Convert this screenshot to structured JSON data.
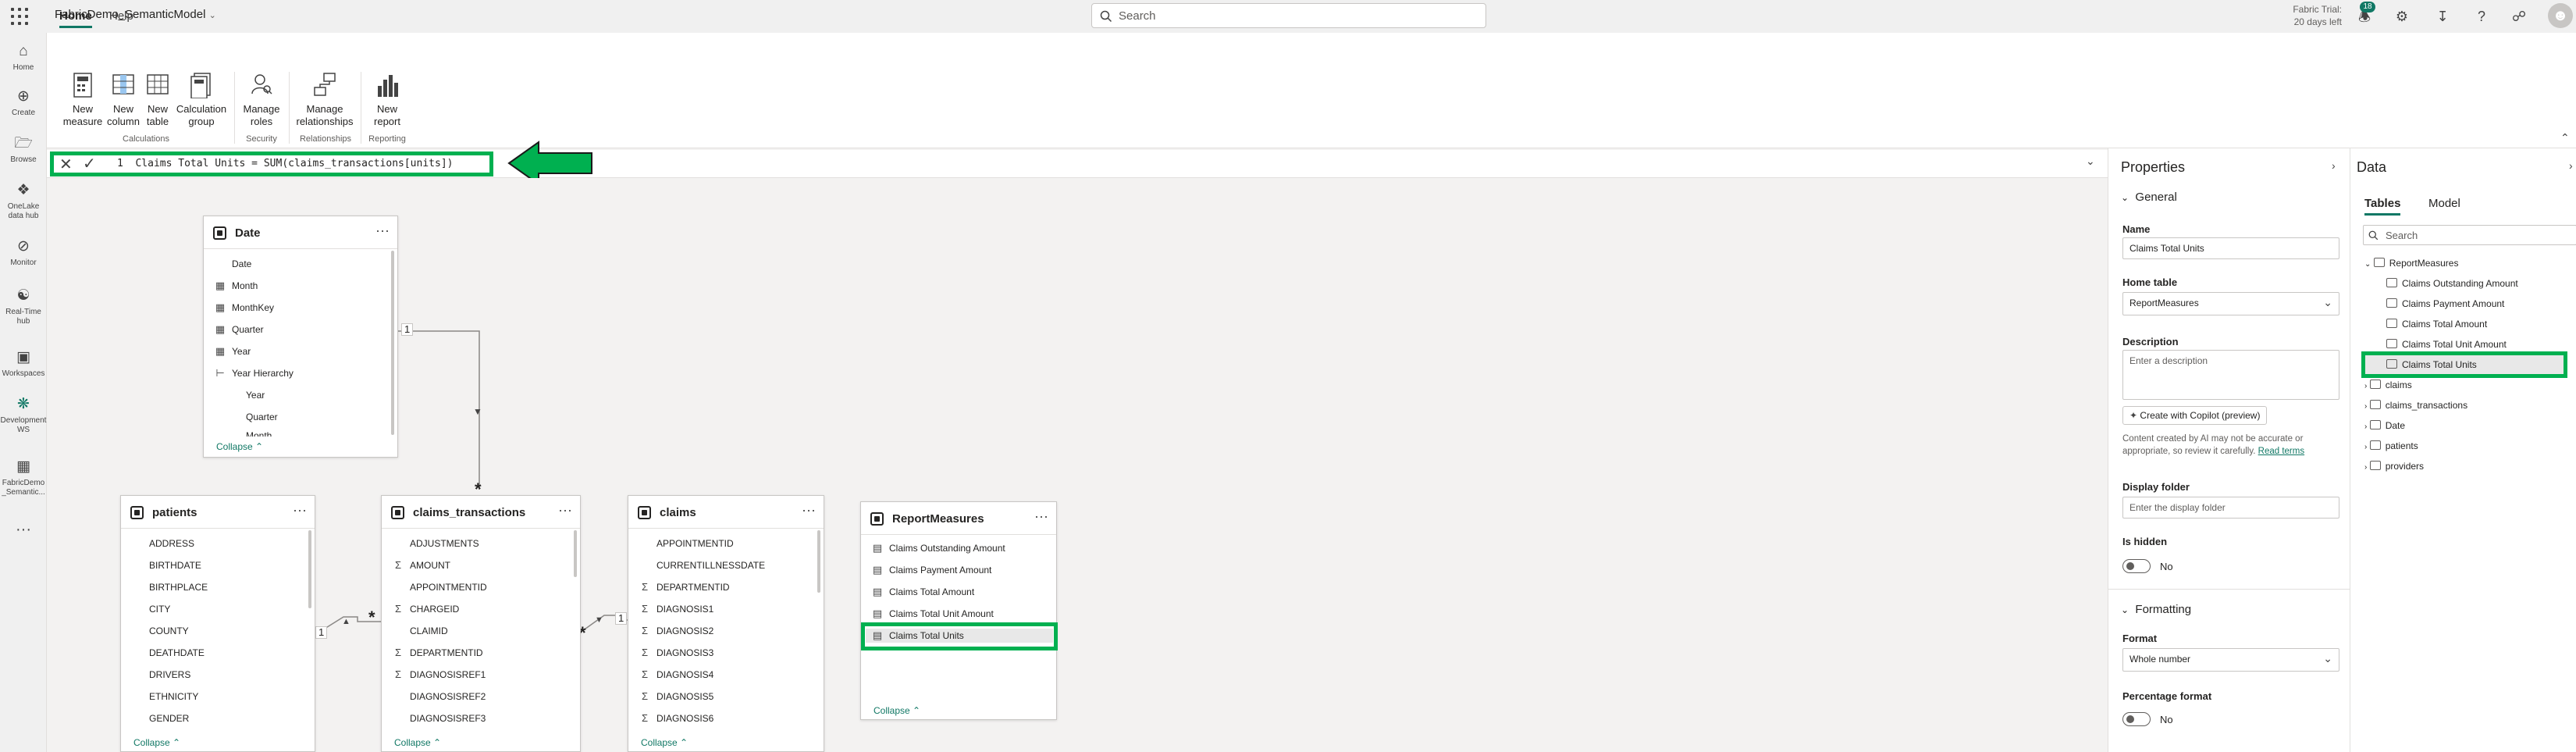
{
  "app": {
    "title": "FabricDemo_SemanticModel",
    "search_placeholder": "Search",
    "trial_line1": "Fabric Trial:",
    "trial_line2": "20 days left",
    "notification_count": "18"
  },
  "leftnav": [
    {
      "label": "Home"
    },
    {
      "label": "Create"
    },
    {
      "label": "Browse"
    },
    {
      "label": "OneLake data hub"
    },
    {
      "label": "Monitor"
    },
    {
      "label": "Real-Time hub"
    },
    {
      "label": "Workspaces"
    },
    {
      "label": "Development WS"
    },
    {
      "label": "FabricDemo _Semantic..."
    }
  ],
  "ribbon": {
    "tabs": [
      "Home",
      "Help"
    ],
    "buttons": {
      "new_measure": "New measure",
      "new_column": "New column",
      "new_table": "New table",
      "calc_group": "Calculation group",
      "manage_roles": "Manage roles",
      "manage_relationships": "Manage relationships",
      "new_report": "New report"
    },
    "groups": {
      "calculations": "Calculations",
      "security": "Security",
      "relationships": "Relationships",
      "reporting": "Reporting"
    }
  },
  "formula": {
    "text": "1  Claims Total Units = SUM(claims_transactions[units])"
  },
  "tables": {
    "date": {
      "name": "Date",
      "fields": [
        "Date",
        "Month",
        "MonthKey",
        "Quarter",
        "Year",
        "Year Hierarchy",
        "Year",
        "Quarter",
        "Month"
      ],
      "collapse": "Collapse"
    },
    "patients": {
      "name": "patients",
      "fields": [
        "ADDRESS",
        "BIRTHDATE",
        "BIRTHPLACE",
        "CITY",
        "COUNTY",
        "DEATHDATE",
        "DRIVERS",
        "ETHNICITY",
        "GENDER"
      ],
      "collapse": "Collapse"
    },
    "claims_transactions": {
      "name": "claims_transactions",
      "fields": [
        "ADJUSTMENTS",
        "AMOUNT",
        "APPOINTMENTID",
        "CHARGEID",
        "CLAIMID",
        "DEPARTMENTID",
        "DIAGNOSISREF1",
        "DIAGNOSISREF2",
        "DIAGNOSISREF3"
      ],
      "collapse": "Collapse"
    },
    "claims": {
      "name": "claims",
      "fields": [
        "APPOINTMENTID",
        "CURRENTILLNESSDATE",
        "DEPARTMENTID",
        "DIAGNOSIS1",
        "DIAGNOSIS2",
        "DIAGNOSIS3",
        "DIAGNOSIS4",
        "DIAGNOSIS5",
        "DIAGNOSIS6"
      ],
      "collapse": "Collapse"
    },
    "reportmeasures": {
      "name": "ReportMeasures",
      "fields": [
        "Claims Outstanding Amount",
        "Claims Payment Amount",
        "Claims Total Amount",
        "Claims Total Unit Amount",
        "Claims Total Units"
      ],
      "collapse": "Collapse"
    }
  },
  "relationships": {
    "one": "1",
    "many": "*"
  },
  "properties": {
    "title": "Properties",
    "general": "General",
    "name_label": "Name",
    "name_value": "Claims Total Units",
    "home_table_label": "Home table",
    "home_table_value": "ReportMeasures",
    "description_label": "Description",
    "description_placeholder": "Enter a description",
    "copilot_button": "Create with Copilot (preview)",
    "ai_note": "Content created by AI may not be accurate or appropriate, so review it carefully.",
    "read_terms": "Read terms",
    "display_folder_label": "Display folder",
    "display_folder_placeholder": "Enter the display folder",
    "is_hidden_label": "Is hidden",
    "is_hidden_value": "No",
    "formatting": "Formatting",
    "format_label": "Format",
    "format_value": "Whole number",
    "percentage_label": "Percentage format",
    "percentage_value": "No"
  },
  "data_pane": {
    "title": "Data",
    "tabs": [
      "Tables",
      "Model"
    ],
    "search_placeholder": "Search",
    "tree": [
      "ReportMeasures",
      "Claims Outstanding Amount",
      "Claims Payment Amount",
      "Claims Total Amount",
      "Claims Total Unit Amount",
      "Claims Total Units",
      "claims",
      "claims_transactions",
      "Date",
      "patients",
      "providers"
    ]
  }
}
